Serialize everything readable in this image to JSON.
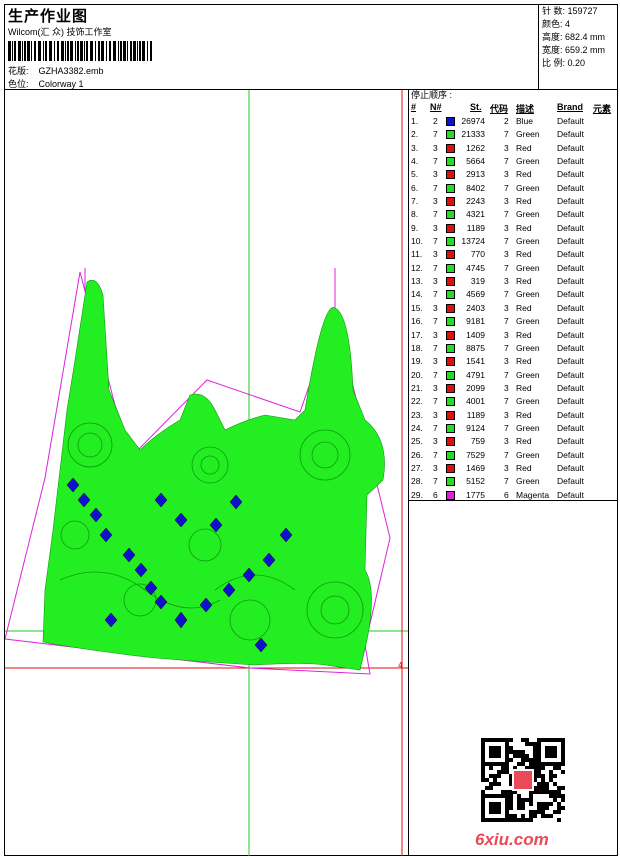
{
  "header": {
    "title": "生产作业图",
    "company": "Wilcom(汇 众) 技饰工作室",
    "design_label": "花版:",
    "design_value": "GZHA3382.emb",
    "colorway_label": "色位:",
    "colorway_value": "Colorway 1"
  },
  "stats": {
    "stitches": "针 数: 159727",
    "colors": "颜色: 4",
    "height": "高度: 682.4 mm",
    "width": "宽度: 659.2 mm",
    "scale": "比 例: 0.20"
  },
  "stop_sequence": {
    "title": "停止顺序 :",
    "headers": {
      "hash": "#",
      "needle": "N#",
      "stitches": "St.",
      "code": "代码",
      "desc": "描述",
      "brand": "Brand",
      "element": "元素"
    },
    "rows": [
      {
        "idx": "1.",
        "n": "2",
        "color": "#1010d0",
        "st": "26974",
        "code": "2",
        "desc": "Blue",
        "brand": "Default"
      },
      {
        "idx": "2.",
        "n": "7",
        "color": "#22dd22",
        "st": "21333",
        "code": "7",
        "desc": "Green",
        "brand": "Default"
      },
      {
        "idx": "3.",
        "n": "3",
        "color": "#dd1111",
        "st": "1262",
        "code": "3",
        "desc": "Red",
        "brand": "Default"
      },
      {
        "idx": "4.",
        "n": "7",
        "color": "#22dd22",
        "st": "5664",
        "code": "7",
        "desc": "Green",
        "brand": "Default"
      },
      {
        "idx": "5.",
        "n": "3",
        "color": "#dd1111",
        "st": "2913",
        "code": "3",
        "desc": "Red",
        "brand": "Default"
      },
      {
        "idx": "6.",
        "n": "7",
        "color": "#22dd22",
        "st": "8402",
        "code": "7",
        "desc": "Green",
        "brand": "Default"
      },
      {
        "idx": "7.",
        "n": "3",
        "color": "#dd1111",
        "st": "2243",
        "code": "3",
        "desc": "Red",
        "brand": "Default"
      },
      {
        "idx": "8.",
        "n": "7",
        "color": "#22dd22",
        "st": "4321",
        "code": "7",
        "desc": "Green",
        "brand": "Default"
      },
      {
        "idx": "9.",
        "n": "3",
        "color": "#dd1111",
        "st": "1189",
        "code": "3",
        "desc": "Red",
        "brand": "Default"
      },
      {
        "idx": "10.",
        "n": "7",
        "color": "#22dd22",
        "st": "13724",
        "code": "7",
        "desc": "Green",
        "brand": "Default"
      },
      {
        "idx": "11.",
        "n": "3",
        "color": "#dd1111",
        "st": "770",
        "code": "3",
        "desc": "Red",
        "brand": "Default"
      },
      {
        "idx": "12.",
        "n": "7",
        "color": "#22dd22",
        "st": "4745",
        "code": "7",
        "desc": "Green",
        "brand": "Default"
      },
      {
        "idx": "13.",
        "n": "3",
        "color": "#dd1111",
        "st": "319",
        "code": "3",
        "desc": "Red",
        "brand": "Default"
      },
      {
        "idx": "14.",
        "n": "7",
        "color": "#22dd22",
        "st": "4569",
        "code": "7",
        "desc": "Green",
        "brand": "Default"
      },
      {
        "idx": "15.",
        "n": "3",
        "color": "#dd1111",
        "st": "2403",
        "code": "3",
        "desc": "Red",
        "brand": "Default"
      },
      {
        "idx": "16.",
        "n": "7",
        "color": "#22dd22",
        "st": "9181",
        "code": "7",
        "desc": "Green",
        "brand": "Default"
      },
      {
        "idx": "17.",
        "n": "3",
        "color": "#dd1111",
        "st": "1409",
        "code": "3",
        "desc": "Red",
        "brand": "Default"
      },
      {
        "idx": "18.",
        "n": "7",
        "color": "#22dd22",
        "st": "8875",
        "code": "7",
        "desc": "Green",
        "brand": "Default"
      },
      {
        "idx": "19.",
        "n": "3",
        "color": "#dd1111",
        "st": "1541",
        "code": "3",
        "desc": "Red",
        "brand": "Default"
      },
      {
        "idx": "20.",
        "n": "7",
        "color": "#22dd22",
        "st": "4791",
        "code": "7",
        "desc": "Green",
        "brand": "Default"
      },
      {
        "idx": "21.",
        "n": "3",
        "color": "#dd1111",
        "st": "2099",
        "code": "3",
        "desc": "Red",
        "brand": "Default"
      },
      {
        "idx": "22.",
        "n": "7",
        "color": "#22dd22",
        "st": "4001",
        "code": "7",
        "desc": "Green",
        "brand": "Default"
      },
      {
        "idx": "23.",
        "n": "3",
        "color": "#dd1111",
        "st": "1189",
        "code": "3",
        "desc": "Red",
        "brand": "Default"
      },
      {
        "idx": "24.",
        "n": "7",
        "color": "#22dd22",
        "st": "9124",
        "code": "7",
        "desc": "Green",
        "brand": "Default"
      },
      {
        "idx": "25.",
        "n": "3",
        "color": "#dd1111",
        "st": "759",
        "code": "3",
        "desc": "Red",
        "brand": "Default"
      },
      {
        "idx": "26.",
        "n": "7",
        "color": "#22dd22",
        "st": "7529",
        "code": "7",
        "desc": "Green",
        "brand": "Default"
      },
      {
        "idx": "27.",
        "n": "3",
        "color": "#dd1111",
        "st": "1469",
        "code": "3",
        "desc": "Red",
        "brand": "Default"
      },
      {
        "idx": "28.",
        "n": "7",
        "color": "#22dd22",
        "st": "5152",
        "code": "7",
        "desc": "Green",
        "brand": "Default"
      },
      {
        "idx": "29.",
        "n": "6",
        "color": "#dd22dd",
        "st": "1775",
        "code": "6",
        "desc": "Magenta",
        "brand": "Default"
      }
    ]
  },
  "watermark": "6xiu.com",
  "colors": {
    "outline": "#dd22dd",
    "guide_green": "#22cc22",
    "guide_red": "#dd1111",
    "fill_green": "#22ee22",
    "fill_blue": "#1010d0"
  }
}
